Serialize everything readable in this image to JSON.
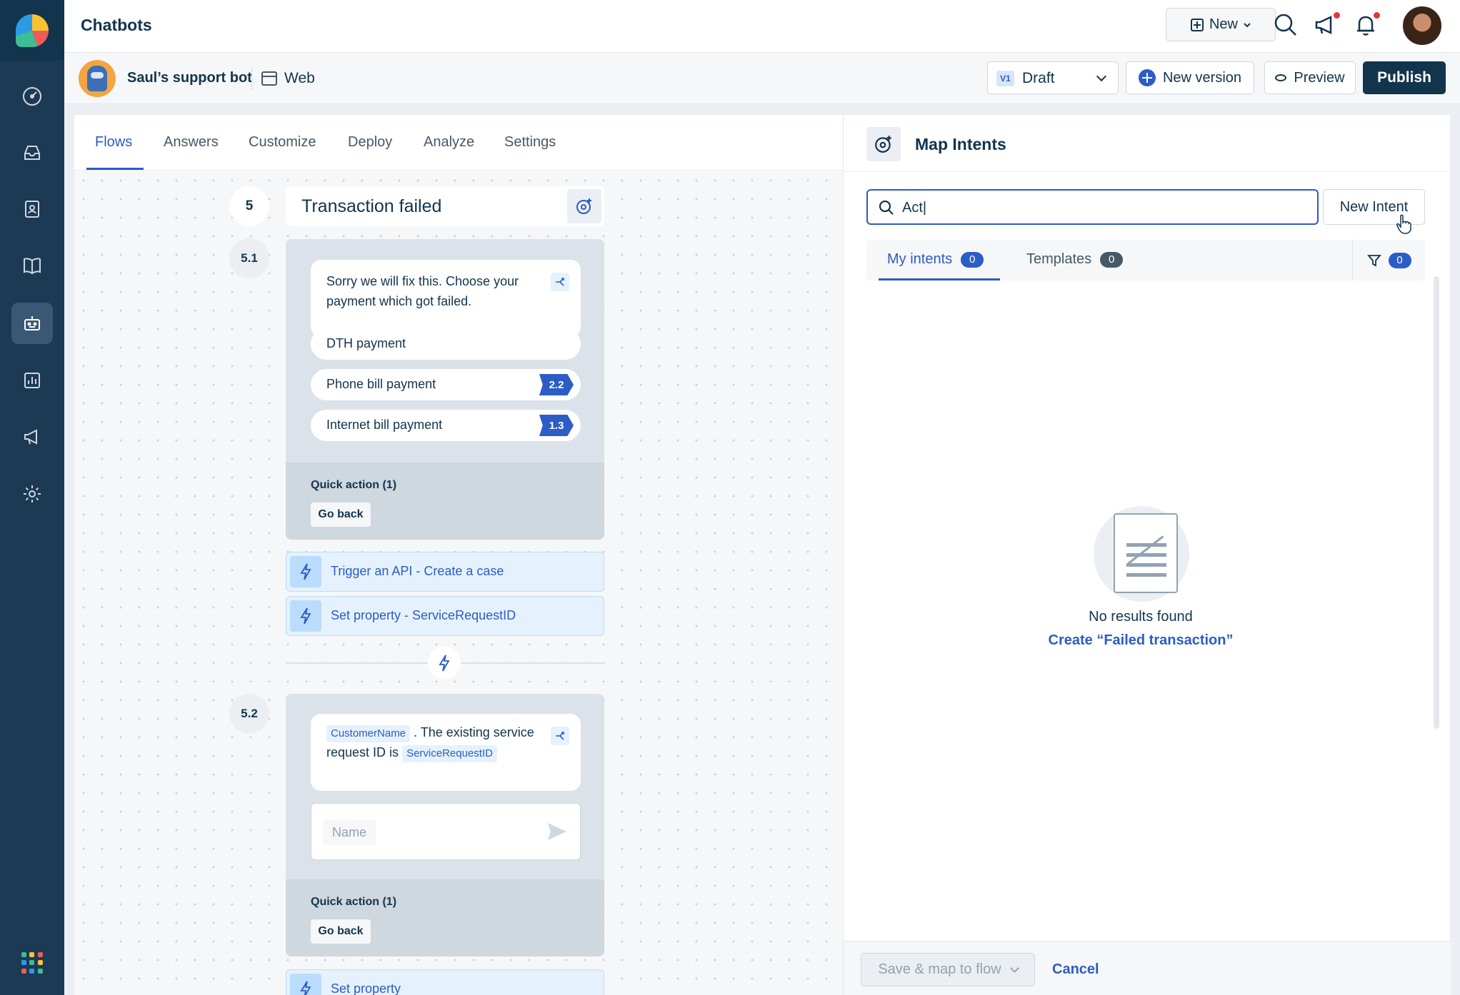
{
  "header": {
    "app_title": "Chatbots",
    "new_label": "New"
  },
  "bot": {
    "name": "Saul’s support bot",
    "channel": "Web"
  },
  "version": {
    "badge": "V1",
    "status": "Draft"
  },
  "actions": {
    "new_version": "New version",
    "preview": "Preview",
    "publish": "Publish"
  },
  "tabs": [
    "Flows",
    "Answers",
    "Customize",
    "Deploy",
    "Analyze",
    "Settings"
  ],
  "flow": {
    "step": "5",
    "title": "Transaction failed",
    "node1": {
      "step": "5.1",
      "message": "Sorry we will fix this. Choose your payment which got failed.",
      "options": [
        {
          "label": "DTH payment",
          "tag": ""
        },
        {
          "label": "Phone bill payment",
          "tag": "2.2"
        },
        {
          "label": "Internet bill payment",
          "tag": "1.3"
        }
      ],
      "quick_action_title": "Quick action (1)",
      "quick_action_button": "Go back"
    },
    "actions": [
      "Trigger an API - Create a case",
      "Set property - ServiceRequestID"
    ],
    "node2": {
      "step": "5.2",
      "var1": "CustomerName",
      "text": ". The existing service request ID is",
      "var2": "ServiceRequestID",
      "input_placeholder": "Name",
      "quick_action_title": "Quick action (1)",
      "quick_action_button": "Go back"
    },
    "trailing_action": "Set property"
  },
  "panel": {
    "title": "Map Intents",
    "search_value": "Act|",
    "new_intent": "New Intent",
    "tabs": [
      {
        "label": "My intents",
        "count": "0"
      },
      {
        "label": "Templates",
        "count": "0"
      }
    ],
    "filter_count": "0",
    "empty_text": "No results found",
    "create_link": "Create “Failed transaction”",
    "save_label": "Save & map to flow",
    "cancel_label": "Cancel"
  },
  "colors": {
    "rail": "#1d3a55",
    "accent": "#2c5cc5",
    "primary_dark": "#12344d"
  }
}
